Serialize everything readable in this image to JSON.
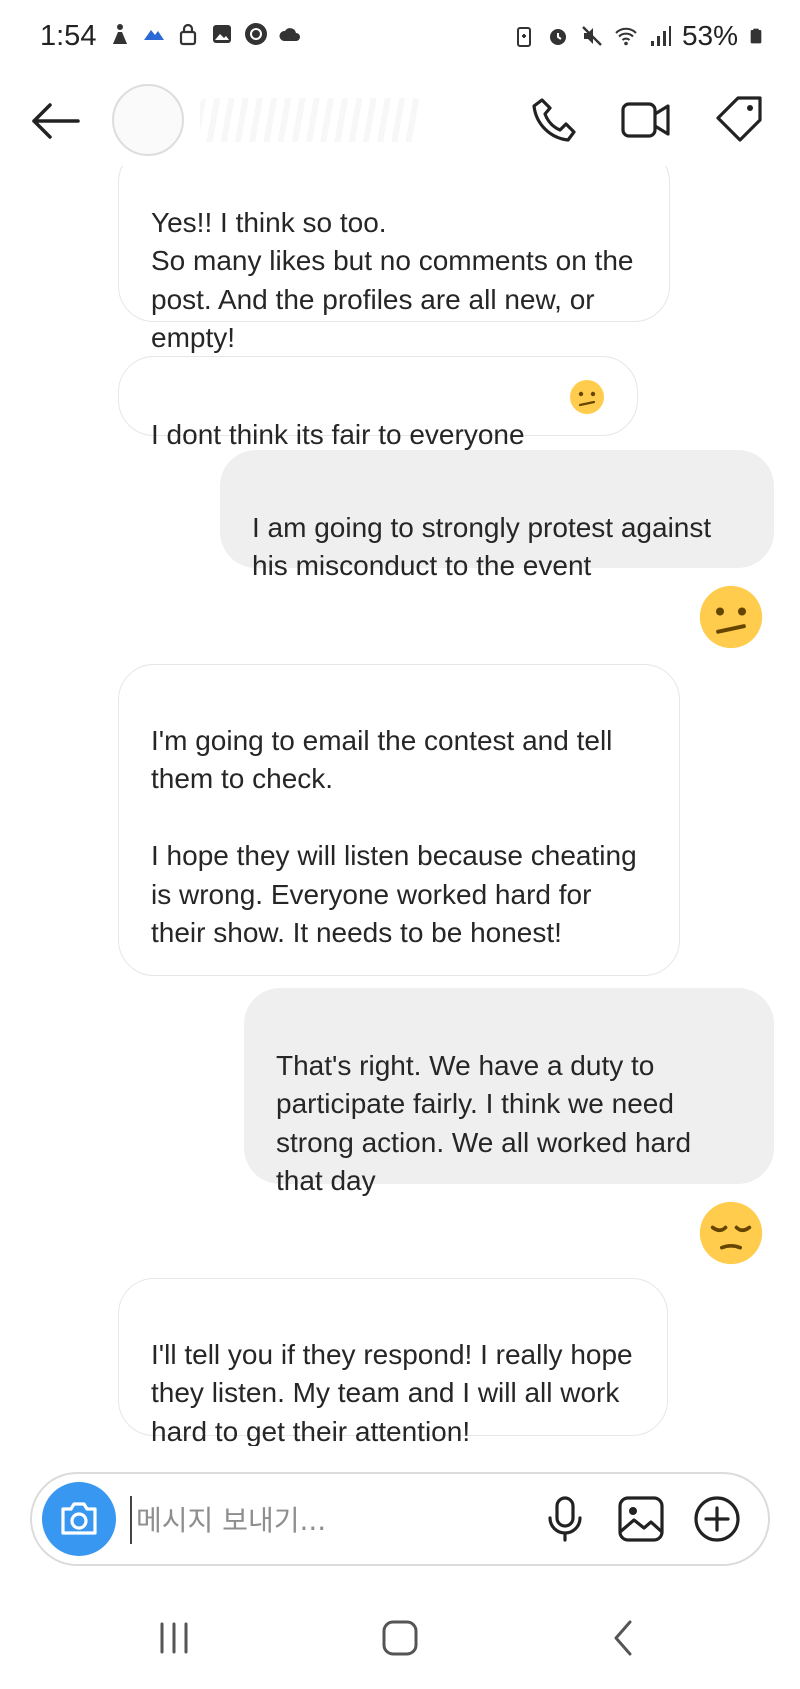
{
  "status_bar": {
    "time": "1:54",
    "battery": "53%",
    "left_icons": [
      "accessibility-icon",
      "mountain-icon",
      "lock-icon",
      "gallery-icon",
      "oklock-icon",
      "cloud-icon"
    ],
    "right_icons": [
      "battery-saver-icon",
      "alarm-icon",
      "mute-icon",
      "wifi-icon",
      "signal-icon",
      "battery-icon"
    ]
  },
  "header": {
    "icons": [
      "back-arrow-icon",
      "phone-icon",
      "video-icon",
      "tag-icon"
    ]
  },
  "messages": [
    {
      "sender": "them",
      "text": "Yes!! I think so too.\nSo many likes but no comments on the post.  And the profiles are all new, or empty!"
    },
    {
      "sender": "them",
      "text": "I dont think its fair to everyone",
      "emoji": "confused-face"
    },
    {
      "sender": "me",
      "text": "I am going to strongly protest against his misconduct to the event"
    },
    {
      "sender": "me",
      "emoji": "confused-face"
    },
    {
      "sender": "them",
      "text": "I'm going to email the contest and tell them to check.\n\nI hope they will listen because cheating is wrong. Everyone worked hard for their show. It needs to be honest!"
    },
    {
      "sender": "me",
      "text": "That's right. We have a duty to participate fairly. I think we need strong action. We all worked hard that day"
    },
    {
      "sender": "me",
      "emoji": "pensive-face"
    },
    {
      "sender": "them",
      "text": "I'll tell you if they respond! I really hope they listen. My team and I will all work hard to get their attention!"
    }
  ],
  "composer": {
    "placeholder": "메시지 보내기...",
    "value": "",
    "icons": [
      "camera-icon",
      "microphone-icon",
      "gallery-icon",
      "add-icon"
    ]
  },
  "nav_bar": {
    "icons": [
      "recent-apps-icon",
      "home-icon",
      "back-icon"
    ]
  },
  "colors": {
    "accent": "#3897f0",
    "sent_bubble": "#efefef",
    "received_border": "#e6e6e6",
    "emoji_yellow": "#ffcc4d"
  }
}
